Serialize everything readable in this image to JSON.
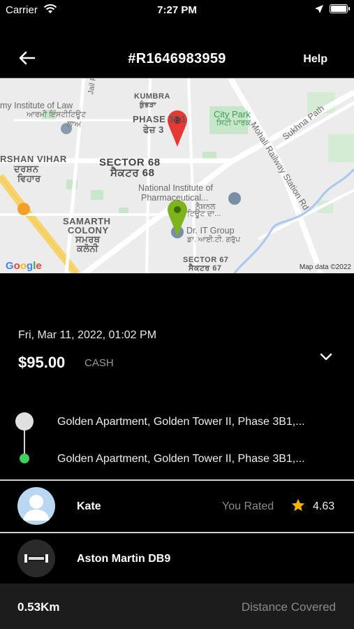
{
  "status_bar": {
    "carrier": "Carrier",
    "time": "7:27 PM"
  },
  "header": {
    "title": "#R1646983959",
    "help_label": "Help",
    "back_icon": "arrow-left-icon"
  },
  "map": {
    "labels": {
      "institute_of_law": "my Institute of Law",
      "institute_of_law_pa": "ਆਰਮੀ ਇੰਸਟੀਟਿਊਟ",
      "law_short": "ਲਾਅ",
      "jail_rd": "Jail Rd",
      "kumbra": "KUMBRA",
      "kumbra_pa": "ਕੁੰਭੜਾ",
      "phase_3b1": "PHASE 3B1",
      "phase_3b1_pa": "ਫੇਜ਼ 3",
      "city_park": "City Park",
      "city_park_pa": "ਸਿਟੀ ਪਾਰਕ",
      "sukhna_path": "Sukhna Path",
      "mohali_station_rd": "Mohali Railway Station Rd",
      "darshan_vihar": "RSHAN VIHAR",
      "darshan_vihar_pa1": "ਦਰਸ਼ਨ",
      "darshan_vihar_pa2": "ਵਿਹਾਰ",
      "sector_68": "SECTOR 68",
      "sector_68_pa": "ਸੈਕਟਰ 68",
      "nip": "National Institute of",
      "nip2": "Pharmaceutical...",
      "nip_pa1": "ਨੈਸ਼ਨਲ",
      "nip_pa2": "ਟਿਊਟ ਦਾ...",
      "samarth": "SAMARTH",
      "colony": "COLONY",
      "samarth_pa1": "ਸਮਰਥ",
      "samarth_pa2": "ਕਲੋਨੀ",
      "dr_it": "Dr. IT Group",
      "dr_it_pa": "ਡਾ. ਆਈ.ਟੀ. ਗਰੁੱਪ",
      "sector_67": "SECTOR 67",
      "sector_67_pa": "ਸੈਕਟਰ 67"
    },
    "google_logo": "Google",
    "attribution": "Map data ©2022",
    "pickup_color": "#7fb31b",
    "dropoff_color": "#e53935"
  },
  "trip": {
    "datetime": "Fri, Mar 11, 2022, 01:02 PM",
    "price": "$95.00",
    "payment": "CASH",
    "pickup": "Golden Apartment, Golden Tower II, Phase 3B1,...",
    "dropoff": "Golden Apartment, Golden Tower II, Phase 3B1,..."
  },
  "driver": {
    "name": "Kate",
    "rated_label": "You Rated",
    "rating": "4.63"
  },
  "vehicle": {
    "name": "Aston Martin DB9"
  },
  "footer": {
    "distance": "0.53Km",
    "distance_label": "Distance Covered"
  },
  "colors": {
    "accent_green": "#3ed15a",
    "star": "#f5b400"
  }
}
